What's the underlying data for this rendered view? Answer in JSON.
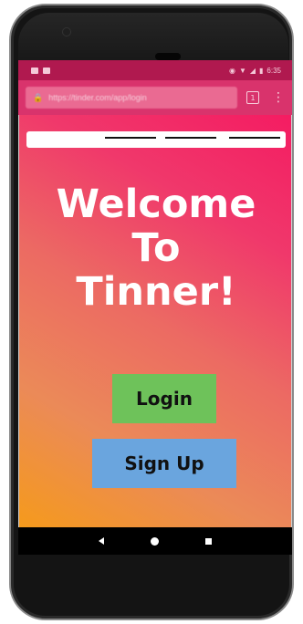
{
  "status_bar": {
    "time": "6:35"
  },
  "browser": {
    "url": "https://tinder.com/app/login",
    "tab_count": "1",
    "menu_glyph": "⋮",
    "lock_glyph": "🔒"
  },
  "page": {
    "heading": "Welcome\nTo\nTinner!",
    "login_label": "Login",
    "signup_label": "Sign Up"
  },
  "colors": {
    "login_button": "#6ec25a",
    "signup_button": "#6aa5de",
    "gradient_start": "#f59a1c",
    "gradient_end": "#f41c62"
  },
  "icons": [
    "lock-icon",
    "tab-switcher-icon",
    "overflow-menu-icon",
    "back-icon",
    "home-icon",
    "recents-icon",
    "wifi-icon",
    "signal-icon",
    "battery-icon"
  ]
}
